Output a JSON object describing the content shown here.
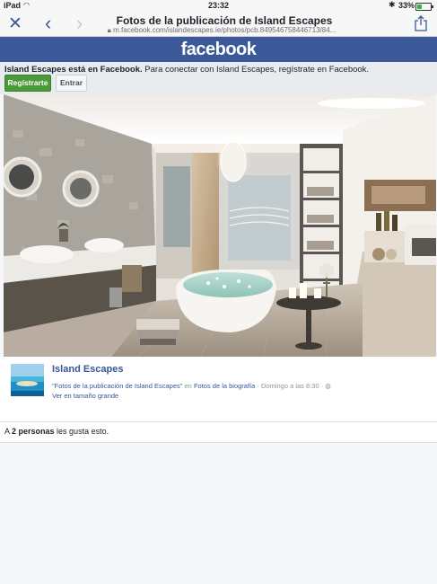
{
  "status_bar": {
    "carrier": "iPad",
    "time": "23:32",
    "battery": "33%"
  },
  "navbar": {
    "title": "Fotos de la publicación de Island Escapes",
    "url": "m.facebook.com/islandescapes.ie/photos/pcb.849546758446713/84..."
  },
  "brand": {
    "logo": "facebook",
    "color": "#3b5998"
  },
  "promo": {
    "bold": "Island Escapes está en Facebook.",
    "text": " Para conectar con Island Escapes, regístrate en Facebook.",
    "register_label": "Regístrarte",
    "login_label": "Entrar"
  },
  "post": {
    "page_name": "Island Escapes",
    "caption_link": "\"Fotos de la publicación de Island Escapes\"",
    "caption_middle": " en ",
    "album_link": "Fotos de la biografía",
    "timestamp": " · Domingo a las 8:30 · ",
    "view_larger": "Ver en tamaño grande"
  },
  "likes": {
    "prefix": "A ",
    "count": "2 personas",
    "suffix": " les gusta esto."
  },
  "icons": [
    "close-icon",
    "back-icon",
    "forward-icon",
    "share-icon",
    "lock-icon",
    "wifi-icon",
    "bluetooth-icon",
    "battery-icon",
    "globe-icon"
  ]
}
